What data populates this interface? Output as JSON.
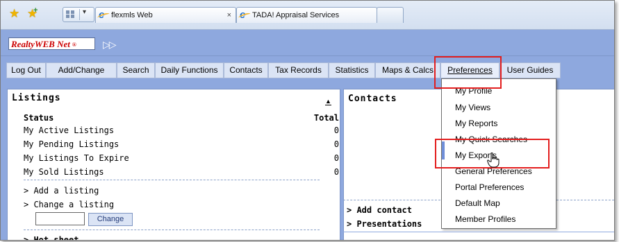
{
  "browser": {
    "tabs": [
      {
        "label": "flexmls Web",
        "close": "×"
      },
      {
        "label": "TADA! Appraisal Services"
      }
    ]
  },
  "site": {
    "logo_text": "RealtyWEB Net",
    "logo_mark": "®",
    "expand_icon": "double-chevron-right-icon"
  },
  "nav": {
    "items": [
      "Log Out",
      "Add/Change",
      "Search",
      "Daily Functions",
      "Contacts",
      "Tax Records",
      "Statistics",
      "Maps & Calcs",
      "Preferences",
      "User Guides"
    ],
    "active": "Preferences"
  },
  "listings": {
    "title": "Listings",
    "header_status": "Status",
    "header_total": "Total",
    "rows": [
      {
        "label": "My Active Listings",
        "value": "0"
      },
      {
        "label": "My Pending Listings",
        "value": "0"
      },
      {
        "label": "My Listings To Expire",
        "value": "0"
      },
      {
        "label": "My Sold Listings",
        "value": "0"
      }
    ],
    "add_link": "> Add a listing",
    "change_link": "> Change a listing",
    "change_button": "Change",
    "change_input_value": "",
    "hot_sheet_link": "> Hot sheet"
  },
  "contacts": {
    "title": "Contacts",
    "add_link": "> Add contact",
    "presentations_link": "> Presentations"
  },
  "preferences_menu": {
    "items": [
      "My Profile",
      "My Views",
      "My Reports",
      "My Quick Searches",
      "My Exports",
      "General Preferences",
      "Portal Preferences",
      "Default Map",
      "Member Profiles"
    ]
  },
  "colors": {
    "header_blue": "#8ea8de",
    "highlight_red": "#e31d1d",
    "logo_red": "#cc0000"
  }
}
